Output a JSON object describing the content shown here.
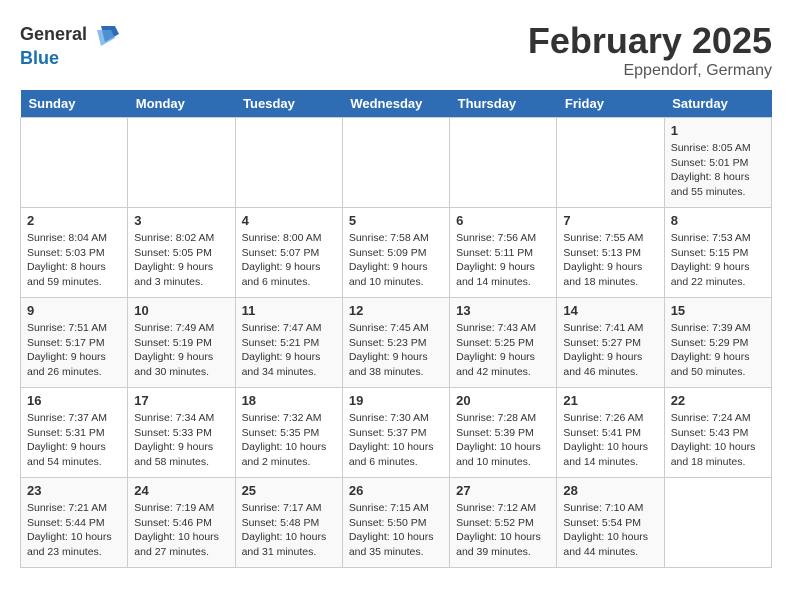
{
  "header": {
    "logo_general": "General",
    "logo_blue": "Blue",
    "month_year": "February 2025",
    "location": "Eppendorf, Germany"
  },
  "weekdays": [
    "Sunday",
    "Monday",
    "Tuesday",
    "Wednesday",
    "Thursday",
    "Friday",
    "Saturday"
  ],
  "weeks": [
    [
      {
        "day": "",
        "info": ""
      },
      {
        "day": "",
        "info": ""
      },
      {
        "day": "",
        "info": ""
      },
      {
        "day": "",
        "info": ""
      },
      {
        "day": "",
        "info": ""
      },
      {
        "day": "",
        "info": ""
      },
      {
        "day": "1",
        "info": "Sunrise: 8:05 AM\nSunset: 5:01 PM\nDaylight: 8 hours and 55 minutes."
      }
    ],
    [
      {
        "day": "2",
        "info": "Sunrise: 8:04 AM\nSunset: 5:03 PM\nDaylight: 8 hours and 59 minutes."
      },
      {
        "day": "3",
        "info": "Sunrise: 8:02 AM\nSunset: 5:05 PM\nDaylight: 9 hours and 3 minutes."
      },
      {
        "day": "4",
        "info": "Sunrise: 8:00 AM\nSunset: 5:07 PM\nDaylight: 9 hours and 6 minutes."
      },
      {
        "day": "5",
        "info": "Sunrise: 7:58 AM\nSunset: 5:09 PM\nDaylight: 9 hours and 10 minutes."
      },
      {
        "day": "6",
        "info": "Sunrise: 7:56 AM\nSunset: 5:11 PM\nDaylight: 9 hours and 14 minutes."
      },
      {
        "day": "7",
        "info": "Sunrise: 7:55 AM\nSunset: 5:13 PM\nDaylight: 9 hours and 18 minutes."
      },
      {
        "day": "8",
        "info": "Sunrise: 7:53 AM\nSunset: 5:15 PM\nDaylight: 9 hours and 22 minutes."
      }
    ],
    [
      {
        "day": "9",
        "info": "Sunrise: 7:51 AM\nSunset: 5:17 PM\nDaylight: 9 hours and 26 minutes."
      },
      {
        "day": "10",
        "info": "Sunrise: 7:49 AM\nSunset: 5:19 PM\nDaylight: 9 hours and 30 minutes."
      },
      {
        "day": "11",
        "info": "Sunrise: 7:47 AM\nSunset: 5:21 PM\nDaylight: 9 hours and 34 minutes."
      },
      {
        "day": "12",
        "info": "Sunrise: 7:45 AM\nSunset: 5:23 PM\nDaylight: 9 hours and 38 minutes."
      },
      {
        "day": "13",
        "info": "Sunrise: 7:43 AM\nSunset: 5:25 PM\nDaylight: 9 hours and 42 minutes."
      },
      {
        "day": "14",
        "info": "Sunrise: 7:41 AM\nSunset: 5:27 PM\nDaylight: 9 hours and 46 minutes."
      },
      {
        "day": "15",
        "info": "Sunrise: 7:39 AM\nSunset: 5:29 PM\nDaylight: 9 hours and 50 minutes."
      }
    ],
    [
      {
        "day": "16",
        "info": "Sunrise: 7:37 AM\nSunset: 5:31 PM\nDaylight: 9 hours and 54 minutes."
      },
      {
        "day": "17",
        "info": "Sunrise: 7:34 AM\nSunset: 5:33 PM\nDaylight: 9 hours and 58 minutes."
      },
      {
        "day": "18",
        "info": "Sunrise: 7:32 AM\nSunset: 5:35 PM\nDaylight: 10 hours and 2 minutes."
      },
      {
        "day": "19",
        "info": "Sunrise: 7:30 AM\nSunset: 5:37 PM\nDaylight: 10 hours and 6 minutes."
      },
      {
        "day": "20",
        "info": "Sunrise: 7:28 AM\nSunset: 5:39 PM\nDaylight: 10 hours and 10 minutes."
      },
      {
        "day": "21",
        "info": "Sunrise: 7:26 AM\nSunset: 5:41 PM\nDaylight: 10 hours and 14 minutes."
      },
      {
        "day": "22",
        "info": "Sunrise: 7:24 AM\nSunset: 5:43 PM\nDaylight: 10 hours and 18 minutes."
      }
    ],
    [
      {
        "day": "23",
        "info": "Sunrise: 7:21 AM\nSunset: 5:44 PM\nDaylight: 10 hours and 23 minutes."
      },
      {
        "day": "24",
        "info": "Sunrise: 7:19 AM\nSunset: 5:46 PM\nDaylight: 10 hours and 27 minutes."
      },
      {
        "day": "25",
        "info": "Sunrise: 7:17 AM\nSunset: 5:48 PM\nDaylight: 10 hours and 31 minutes."
      },
      {
        "day": "26",
        "info": "Sunrise: 7:15 AM\nSunset: 5:50 PM\nDaylight: 10 hours and 35 minutes."
      },
      {
        "day": "27",
        "info": "Sunrise: 7:12 AM\nSunset: 5:52 PM\nDaylight: 10 hours and 39 minutes."
      },
      {
        "day": "28",
        "info": "Sunrise: 7:10 AM\nSunset: 5:54 PM\nDaylight: 10 hours and 44 minutes."
      },
      {
        "day": "",
        "info": ""
      }
    ]
  ]
}
